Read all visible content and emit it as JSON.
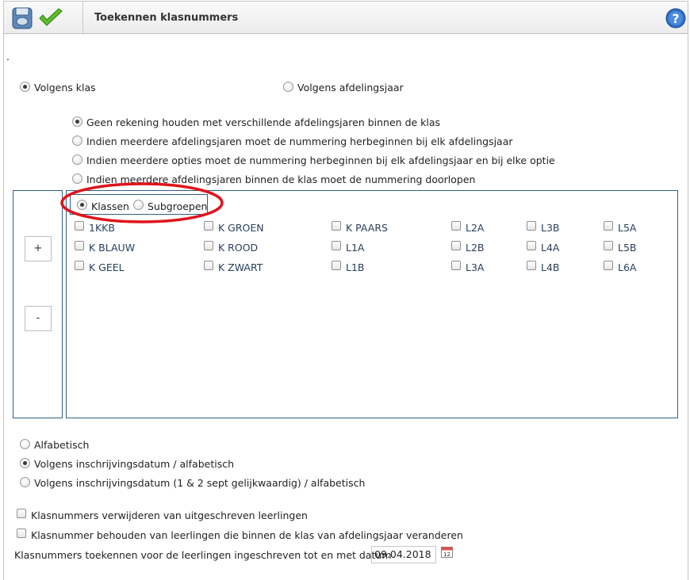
{
  "header": {
    "title": "Toekennen klasnummers"
  },
  "icons": {
    "save": "disk-icon",
    "confirm": "checkmark-icon",
    "help": "help-icon",
    "calendar": "calendar-icon"
  },
  "dot_marker": ".",
  "group_mode": {
    "option_class": "Volgens klas",
    "option_year": "Volgens afdelingsjaar",
    "selected": "Volgens klas"
  },
  "numbering_options": [
    {
      "label": "Geen rekening houden met verschillende afdelingsjaren binnen de klas",
      "selected": true
    },
    {
      "label": "Indien meerdere afdelingsjaren moet de nummering herbeginnen bij elk afdelingsjaar",
      "selected": false
    },
    {
      "label": "Indien meerdere opties moet de nummering herbeginnen bij elk afdelingsjaar en bij elke optie",
      "selected": false
    },
    {
      "label": "Indien meerdere afdelingsjaren binnen de klas moet de nummering doorlopen",
      "selected": false
    }
  ],
  "side_buttons": {
    "plus": "+",
    "minus": "-"
  },
  "selection_type": {
    "classes": "Klassen",
    "subgroups": "Subgroepen",
    "selected": "Klassen"
  },
  "classes": {
    "col1": [
      "1KKB",
      "K BLAUW",
      "K GEEL"
    ],
    "col2": [
      "K GROEN",
      "K ROOD",
      "K ZWART"
    ],
    "col3": [
      "K PAARS",
      "L1A",
      "L1B"
    ],
    "col4": [
      "L2A",
      "L2B",
      "L3A"
    ],
    "col5": [
      "L3B",
      "L4A",
      "L4B"
    ],
    "col6": [
      "L5A",
      "L5B",
      "L6A"
    ]
  },
  "sort_options": [
    {
      "label": "Alfabetisch",
      "selected": false
    },
    {
      "label": "Volgens inschrijvingsdatum / alfabetisch",
      "selected": true
    },
    {
      "label": "Volgens inschrijvingsdatum (1 & 2 sept gelijkwaardig) / alfabetisch",
      "selected": false
    }
  ],
  "extra_options": [
    {
      "label": "Klasnummers verwijderen van uitgeschreven leerlingen",
      "checked": false
    },
    {
      "label": "Klasnummer behouden van leerlingen die binnen de klas van afdelingsjaar veranderen",
      "checked": false
    }
  ],
  "date_row": {
    "label": "Klasnummers toekennen voor de leerlingen ingeschreven tot en met datum",
    "value": "09.04.2018"
  },
  "colors": {
    "annotation_red": "#e0131b",
    "border_blue": "#2f5f8a",
    "link_blue": "#2a3f5c"
  }
}
